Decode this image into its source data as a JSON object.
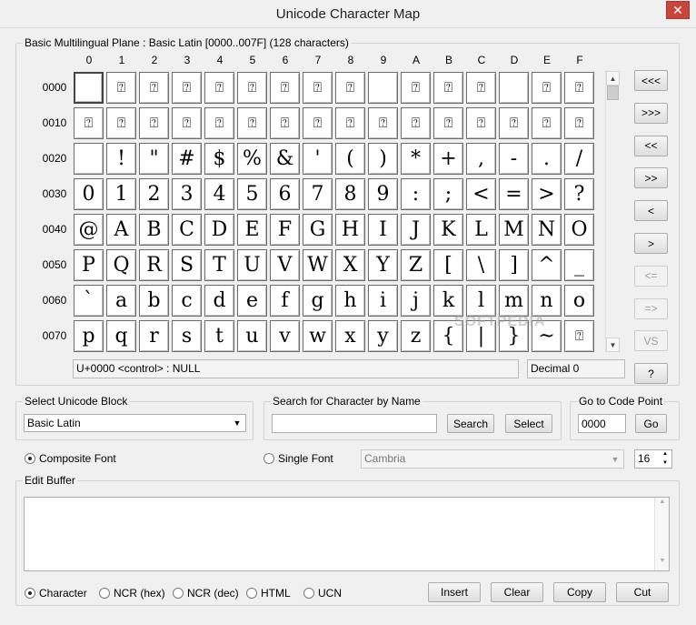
{
  "window": {
    "title": "Unicode Character Map",
    "close_label": "✕"
  },
  "grid": {
    "group_label": "Basic Multilingual Plane : Basic Latin [0000..007F] (128 characters)",
    "col_headers": [
      "0",
      "1",
      "2",
      "3",
      "4",
      "5",
      "6",
      "7",
      "8",
      "9",
      "A",
      "B",
      "C",
      "D",
      "E",
      "F"
    ],
    "row_headers": [
      "0000",
      "0010",
      "0020",
      "0030",
      "0040",
      "0050",
      "0060",
      "0070"
    ],
    "rows": [
      [
        "",
        "⍰",
        "⍰",
        "⍰",
        "⍰",
        "⍰",
        "⍰",
        "⍰",
        "⍰",
        "",
        "⍰",
        "⍰",
        "⍰",
        "",
        "⍰",
        "⍰"
      ],
      [
        "⍰",
        "⍰",
        "⍰",
        "⍰",
        "⍰",
        "⍰",
        "⍰",
        "⍰",
        "⍰",
        "⍰",
        "⍰",
        "⍰",
        "⍰",
        "⍰",
        "⍰",
        "⍰"
      ],
      [
        "",
        "!",
        "\"",
        "#",
        "$",
        "%",
        "&",
        "'",
        "(",
        ")",
        "*",
        "+",
        ",",
        "-",
        ".",
        "/"
      ],
      [
        "0",
        "1",
        "2",
        "3",
        "4",
        "5",
        "6",
        "7",
        "8",
        "9",
        ":",
        ";",
        "<",
        "=",
        ">",
        "?"
      ],
      [
        "@",
        "A",
        "B",
        "C",
        "D",
        "E",
        "F",
        "G",
        "H",
        "I",
        "J",
        "K",
        "L",
        "M",
        "N",
        "O"
      ],
      [
        "P",
        "Q",
        "R",
        "S",
        "T",
        "U",
        "V",
        "W",
        "X",
        "Y",
        "Z",
        "[",
        "\\",
        "]",
        "^",
        "_"
      ],
      [
        "`",
        "a",
        "b",
        "c",
        "d",
        "e",
        "f",
        "g",
        "h",
        "i",
        "j",
        "k",
        "l",
        "m",
        "n",
        "o"
      ],
      [
        "p",
        "q",
        "r",
        "s",
        "t",
        "u",
        "v",
        "w",
        "x",
        "y",
        "z",
        "{",
        "|",
        "}",
        "~",
        "⍰"
      ]
    ],
    "status_left": "U+0000 <control> : NULL",
    "status_right": "Decimal 0"
  },
  "nav_buttons": [
    "<<<",
    ">>>",
    "<<",
    ">>",
    "<",
    ">",
    "<=",
    "=>",
    "VS",
    "?"
  ],
  "block": {
    "group_label": "Select Unicode Block",
    "value": "Basic Latin"
  },
  "search": {
    "group_label": "Search for Character by Name",
    "value": "",
    "search_label": "Search",
    "select_label": "Select"
  },
  "goto": {
    "group_label": "Go to Code Point",
    "value": "0000",
    "go_label": "Go"
  },
  "font": {
    "composite_label": "Composite Font",
    "single_label": "Single Font",
    "font_value": "Cambria",
    "size_value": "16"
  },
  "edit_buffer": {
    "group_label": "Edit Buffer",
    "value": ""
  },
  "output_modes": [
    "Character",
    "NCR (hex)",
    "NCR (dec)",
    "HTML",
    "UCN"
  ],
  "actions": {
    "insert": "Insert",
    "clear": "Clear",
    "copy": "Copy",
    "cut": "Cut"
  },
  "watermark": "SOFTPEDIA"
}
